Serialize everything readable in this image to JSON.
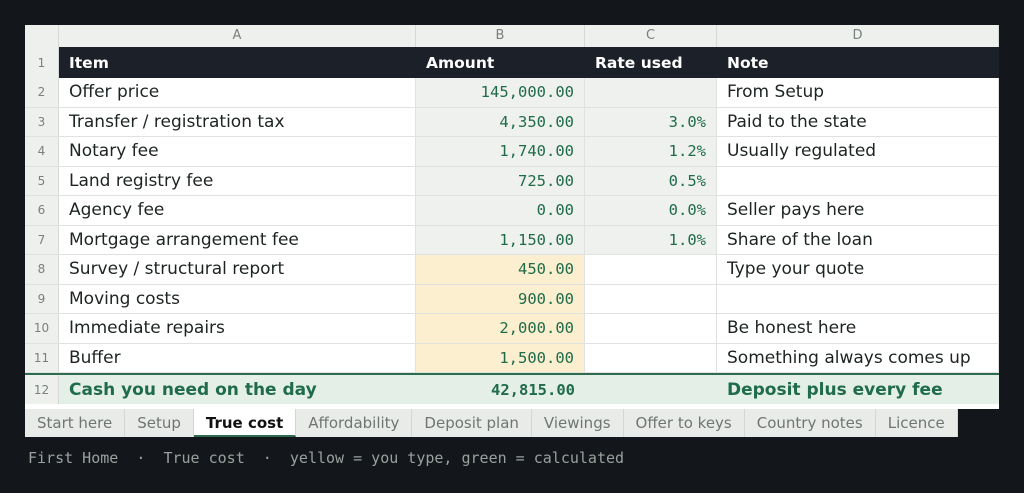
{
  "columns": [
    "A",
    "B",
    "C",
    "D"
  ],
  "header": {
    "num": "1",
    "item": "Item",
    "amount": "Amount",
    "rate": "Rate used",
    "note": "Note"
  },
  "rows": [
    {
      "num": "2",
      "item": "Offer price",
      "amount": "145,000.00",
      "rate": "",
      "note": "From Setup",
      "type": "calc"
    },
    {
      "num": "3",
      "item": "Transfer / registration tax",
      "amount": "4,350.00",
      "rate": "3.0%",
      "note": "Paid to the state",
      "type": "calc"
    },
    {
      "num": "4",
      "item": "Notary fee",
      "amount": "1,740.00",
      "rate": "1.2%",
      "note": "Usually regulated",
      "type": "calc"
    },
    {
      "num": "5",
      "item": "Land registry fee",
      "amount": "725.00",
      "rate": "0.5%",
      "note": "",
      "type": "calc"
    },
    {
      "num": "6",
      "item": "Agency fee",
      "amount": "0.00",
      "rate": "0.0%",
      "note": "Seller pays here",
      "type": "calc"
    },
    {
      "num": "7",
      "item": "Mortgage arrangement fee",
      "amount": "1,150.00",
      "rate": "1.0%",
      "note": "Share of the loan",
      "type": "calc"
    },
    {
      "num": "8",
      "item": "Survey / structural report",
      "amount": "450.00",
      "rate": "",
      "note": "Type your quote",
      "type": "input"
    },
    {
      "num": "9",
      "item": "Moving costs",
      "amount": "900.00",
      "rate": "",
      "note": "",
      "type": "input"
    },
    {
      "num": "10",
      "item": "Immediate repairs",
      "amount": "2,000.00",
      "rate": "",
      "note": "Be honest here",
      "type": "input"
    },
    {
      "num": "11",
      "item": "Buffer",
      "amount": "1,500.00",
      "rate": "",
      "note": "Something always comes up",
      "type": "input"
    }
  ],
  "total": {
    "num": "12",
    "item": "Cash you need on the day",
    "amount": "42,815.00",
    "rate": "",
    "note": "Deposit plus every fee"
  },
  "tabs": [
    {
      "label": "Start here",
      "active": false
    },
    {
      "label": "Setup",
      "active": false
    },
    {
      "label": "True cost",
      "active": true
    },
    {
      "label": "Affordability",
      "active": false
    },
    {
      "label": "Deposit plan",
      "active": false
    },
    {
      "label": "Viewings",
      "active": false
    },
    {
      "label": "Offer to keys",
      "active": false
    },
    {
      "label": "Country notes",
      "active": false
    },
    {
      "label": "Licence",
      "active": false
    }
  ],
  "status": "First Home  ·  True cost  ·  yellow = you type, green = calculated",
  "colors": {
    "input_fill": "#fbefcf",
    "calc_fill": "#eff1ef",
    "header_bg": "#1c2129",
    "accent_green": "#1f6b4a"
  }
}
